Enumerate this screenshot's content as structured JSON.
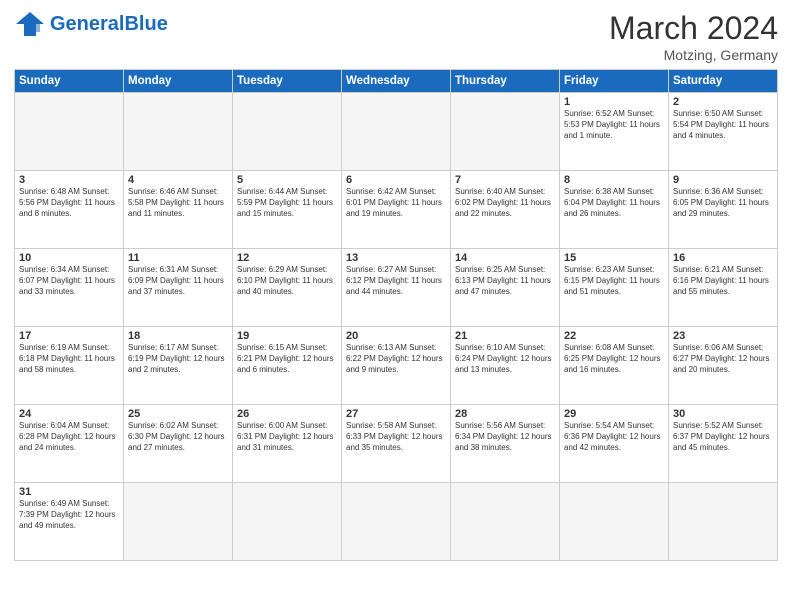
{
  "header": {
    "logo_general": "General",
    "logo_blue": "Blue",
    "month": "March 2024",
    "location": "Motzing, Germany"
  },
  "weekdays": [
    "Sunday",
    "Monday",
    "Tuesday",
    "Wednesday",
    "Thursday",
    "Friday",
    "Saturday"
  ],
  "weeks": [
    [
      {
        "day": "",
        "empty": true
      },
      {
        "day": "",
        "empty": true
      },
      {
        "day": "",
        "empty": true
      },
      {
        "day": "",
        "empty": true
      },
      {
        "day": "",
        "empty": true
      },
      {
        "day": "1",
        "info": "Sunrise: 6:52 AM\nSunset: 5:53 PM\nDaylight: 11 hours\nand 1 minute."
      },
      {
        "day": "2",
        "info": "Sunrise: 6:50 AM\nSunset: 5:54 PM\nDaylight: 11 hours\nand 4 minutes."
      }
    ],
    [
      {
        "day": "3",
        "info": "Sunrise: 6:48 AM\nSunset: 5:56 PM\nDaylight: 11 hours\nand 8 minutes."
      },
      {
        "day": "4",
        "info": "Sunrise: 6:46 AM\nSunset: 5:58 PM\nDaylight: 11 hours\nand 11 minutes."
      },
      {
        "day": "5",
        "info": "Sunrise: 6:44 AM\nSunset: 5:59 PM\nDaylight: 11 hours\nand 15 minutes."
      },
      {
        "day": "6",
        "info": "Sunrise: 6:42 AM\nSunset: 6:01 PM\nDaylight: 11 hours\nand 19 minutes."
      },
      {
        "day": "7",
        "info": "Sunrise: 6:40 AM\nSunset: 6:02 PM\nDaylight: 11 hours\nand 22 minutes."
      },
      {
        "day": "8",
        "info": "Sunrise: 6:38 AM\nSunset: 6:04 PM\nDaylight: 11 hours\nand 26 minutes."
      },
      {
        "day": "9",
        "info": "Sunrise: 6:36 AM\nSunset: 6:05 PM\nDaylight: 11 hours\nand 29 minutes."
      }
    ],
    [
      {
        "day": "10",
        "info": "Sunrise: 6:34 AM\nSunset: 6:07 PM\nDaylight: 11 hours\nand 33 minutes."
      },
      {
        "day": "11",
        "info": "Sunrise: 6:31 AM\nSunset: 6:09 PM\nDaylight: 11 hours\nand 37 minutes."
      },
      {
        "day": "12",
        "info": "Sunrise: 6:29 AM\nSunset: 6:10 PM\nDaylight: 11 hours\nand 40 minutes."
      },
      {
        "day": "13",
        "info": "Sunrise: 6:27 AM\nSunset: 6:12 PM\nDaylight: 11 hours\nand 44 minutes."
      },
      {
        "day": "14",
        "info": "Sunrise: 6:25 AM\nSunset: 6:13 PM\nDaylight: 11 hours\nand 47 minutes."
      },
      {
        "day": "15",
        "info": "Sunrise: 6:23 AM\nSunset: 6:15 PM\nDaylight: 11 hours\nand 51 minutes."
      },
      {
        "day": "16",
        "info": "Sunrise: 6:21 AM\nSunset: 6:16 PM\nDaylight: 11 hours\nand 55 minutes."
      }
    ],
    [
      {
        "day": "17",
        "info": "Sunrise: 6:19 AM\nSunset: 6:18 PM\nDaylight: 11 hours\nand 58 minutes."
      },
      {
        "day": "18",
        "info": "Sunrise: 6:17 AM\nSunset: 6:19 PM\nDaylight: 12 hours\nand 2 minutes."
      },
      {
        "day": "19",
        "info": "Sunrise: 6:15 AM\nSunset: 6:21 PM\nDaylight: 12 hours\nand 6 minutes."
      },
      {
        "day": "20",
        "info": "Sunrise: 6:13 AM\nSunset: 6:22 PM\nDaylight: 12 hours\nand 9 minutes."
      },
      {
        "day": "21",
        "info": "Sunrise: 6:10 AM\nSunset: 6:24 PM\nDaylight: 12 hours\nand 13 minutes."
      },
      {
        "day": "22",
        "info": "Sunrise: 6:08 AM\nSunset: 6:25 PM\nDaylight: 12 hours\nand 16 minutes."
      },
      {
        "day": "23",
        "info": "Sunrise: 6:06 AM\nSunset: 6:27 PM\nDaylight: 12 hours\nand 20 minutes."
      }
    ],
    [
      {
        "day": "24",
        "info": "Sunrise: 6:04 AM\nSunset: 6:28 PM\nDaylight: 12 hours\nand 24 minutes."
      },
      {
        "day": "25",
        "info": "Sunrise: 6:02 AM\nSunset: 6:30 PM\nDaylight: 12 hours\nand 27 minutes."
      },
      {
        "day": "26",
        "info": "Sunrise: 6:00 AM\nSunset: 6:31 PM\nDaylight: 12 hours\nand 31 minutes."
      },
      {
        "day": "27",
        "info": "Sunrise: 5:58 AM\nSunset: 6:33 PM\nDaylight: 12 hours\nand 35 minutes."
      },
      {
        "day": "28",
        "info": "Sunrise: 5:56 AM\nSunset: 6:34 PM\nDaylight: 12 hours\nand 38 minutes."
      },
      {
        "day": "29",
        "info": "Sunrise: 5:54 AM\nSunset: 6:36 PM\nDaylight: 12 hours\nand 42 minutes."
      },
      {
        "day": "30",
        "info": "Sunrise: 5:52 AM\nSunset: 6:37 PM\nDaylight: 12 hours\nand 45 minutes."
      }
    ],
    [
      {
        "day": "31",
        "info": "Sunrise: 6:49 AM\nSunset: 7:39 PM\nDaylight: 12 hours\nand 49 minutes."
      },
      {
        "day": "",
        "empty": true
      },
      {
        "day": "",
        "empty": true
      },
      {
        "day": "",
        "empty": true
      },
      {
        "day": "",
        "empty": true
      },
      {
        "day": "",
        "empty": true
      },
      {
        "day": "",
        "empty": true
      }
    ]
  ]
}
